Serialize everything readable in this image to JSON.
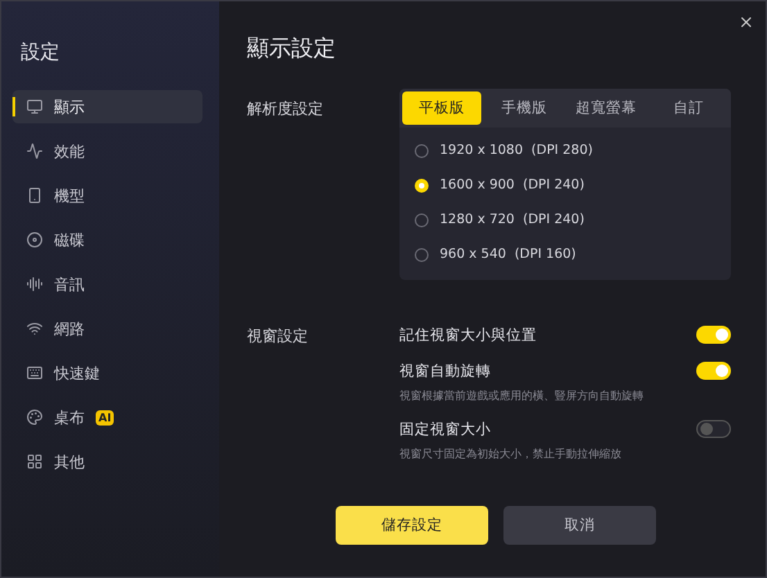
{
  "sidebar": {
    "title": "設定",
    "items": [
      {
        "label": "顯示",
        "selected": true
      },
      {
        "label": "效能",
        "selected": false
      },
      {
        "label": "機型",
        "selected": false
      },
      {
        "label": "磁碟",
        "selected": false
      },
      {
        "label": "音訊",
        "selected": false
      },
      {
        "label": "網路",
        "selected": false
      },
      {
        "label": "快速鍵",
        "selected": false
      },
      {
        "label": "桌布",
        "selected": false,
        "badge": "AI"
      },
      {
        "label": "其他",
        "selected": false
      }
    ]
  },
  "page": {
    "title": "顯示設定"
  },
  "resolution": {
    "label": "解析度設定",
    "tabs": [
      {
        "label": "平板版",
        "selected": true
      },
      {
        "label": "手機版",
        "selected": false
      },
      {
        "label": "超寬螢幕",
        "selected": false
      },
      {
        "label": "自訂",
        "selected": false
      }
    ],
    "options": [
      {
        "label": "1920 x 1080  (DPI 280)",
        "selected": false
      },
      {
        "label": "1600 x 900  (DPI 240)",
        "selected": true
      },
      {
        "label": "1280 x 720  (DPI 240)",
        "selected": false
      },
      {
        "label": "960 x 540  (DPI 160)",
        "selected": false
      }
    ]
  },
  "window_settings": {
    "label": "視窗設定",
    "items": [
      {
        "title": "記住視窗大小與位置",
        "on": true
      },
      {
        "title": "視窗自動旋轉",
        "description": "視窗根據當前遊戲或應用的橫、豎屏方向自動旋轉",
        "on": true
      },
      {
        "title": "固定視窗大小",
        "description": "視窗尺寸固定為初始大小，禁止手動拉伸縮放",
        "on": false
      }
    ]
  },
  "buttons": {
    "save": "儲存設定",
    "cancel": "取消"
  }
}
